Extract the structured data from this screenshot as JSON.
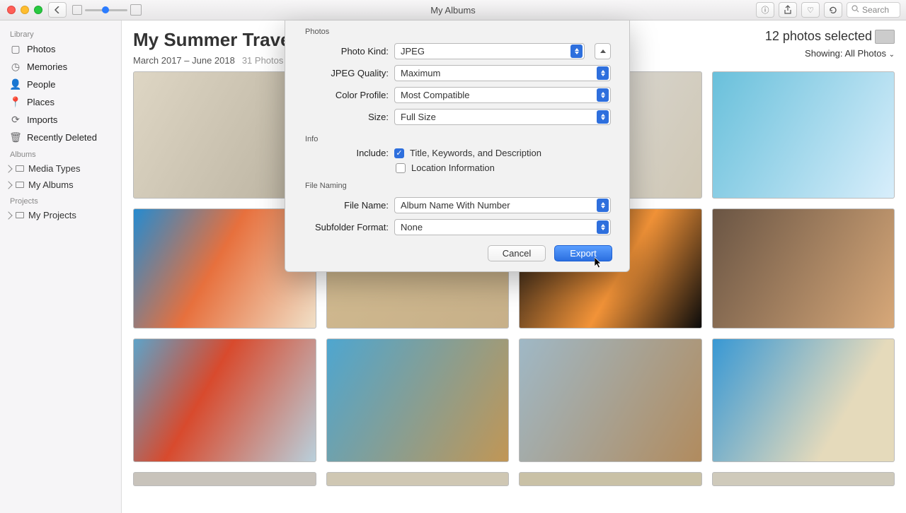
{
  "toolbar": {
    "title": "My Albums",
    "search_placeholder": "Search"
  },
  "sidebar": {
    "library_header": "Library",
    "items": [
      {
        "label": "Photos"
      },
      {
        "label": "Memories"
      },
      {
        "label": "People"
      },
      {
        "label": "Places"
      },
      {
        "label": "Imports"
      },
      {
        "label": "Recently Deleted"
      }
    ],
    "albums_header": "Albums",
    "album_items": [
      {
        "label": "Media Types"
      },
      {
        "label": "My Albums"
      }
    ],
    "projects_header": "Projects",
    "project_items": [
      {
        "label": "My Projects"
      }
    ]
  },
  "album": {
    "title": "My Summer Travels",
    "date_range": "March 2017 – June 2018",
    "count_label": "31 Photos",
    "selected_label": "12 photos selected",
    "showing_label": "Showing:",
    "showing_value": "All Photos"
  },
  "dialog": {
    "sections": {
      "photos": "Photos",
      "info": "Info",
      "naming": "File Naming"
    },
    "labels": {
      "photo_kind": "Photo Kind:",
      "jpeg_quality": "JPEG Quality:",
      "color_profile": "Color Profile:",
      "size": "Size:",
      "include": "Include:",
      "file_name": "File Name:",
      "subfolder": "Subfolder Format:"
    },
    "values": {
      "photo_kind": "JPEG",
      "jpeg_quality": "Maximum",
      "color_profile": "Most Compatible",
      "size": "Full Size",
      "include_title": "Title, Keywords, and Description",
      "include_location": "Location Information",
      "file_name": "Album Name With Number",
      "subfolder": "None"
    },
    "checks": {
      "title": true,
      "location": false
    },
    "buttons": {
      "cancel": "Cancel",
      "export": "Export"
    }
  }
}
